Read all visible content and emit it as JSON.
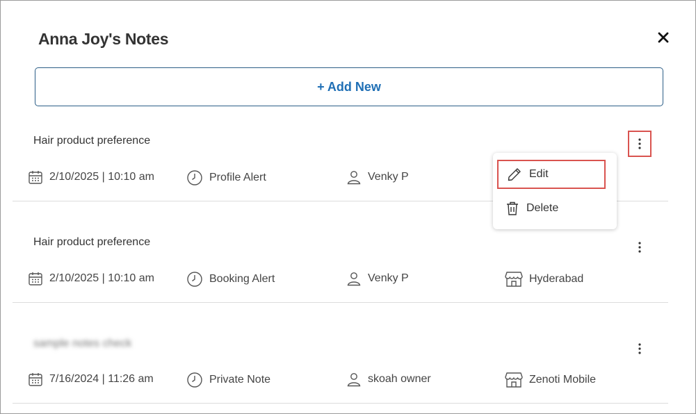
{
  "modal": {
    "title": "Anna Joy's Notes",
    "close_icon": "close-icon",
    "add_button_label": "+ Add New"
  },
  "notes": [
    {
      "title": "Hair product preference",
      "date": "2/10/2025 | 10:10 am",
      "type": "Profile Alert",
      "author": "Venky P",
      "location": ""
    },
    {
      "title": "Hair product preference",
      "date": "2/10/2025 | 10:10 am",
      "type": "Booking Alert",
      "author": "Venky P",
      "location": "Hyderabad"
    },
    {
      "title": "sample notes check",
      "date": "7/16/2024 | 11:26 am",
      "type": "Private Note",
      "author": "skoah owner",
      "location": "Zenoti Mobile"
    }
  ],
  "context_menu": {
    "edit_label": "Edit",
    "delete_label": "Delete"
  },
  "colors": {
    "accent": "#1f6fb5",
    "border": "#2b5d86",
    "highlight": "#d9534f"
  }
}
